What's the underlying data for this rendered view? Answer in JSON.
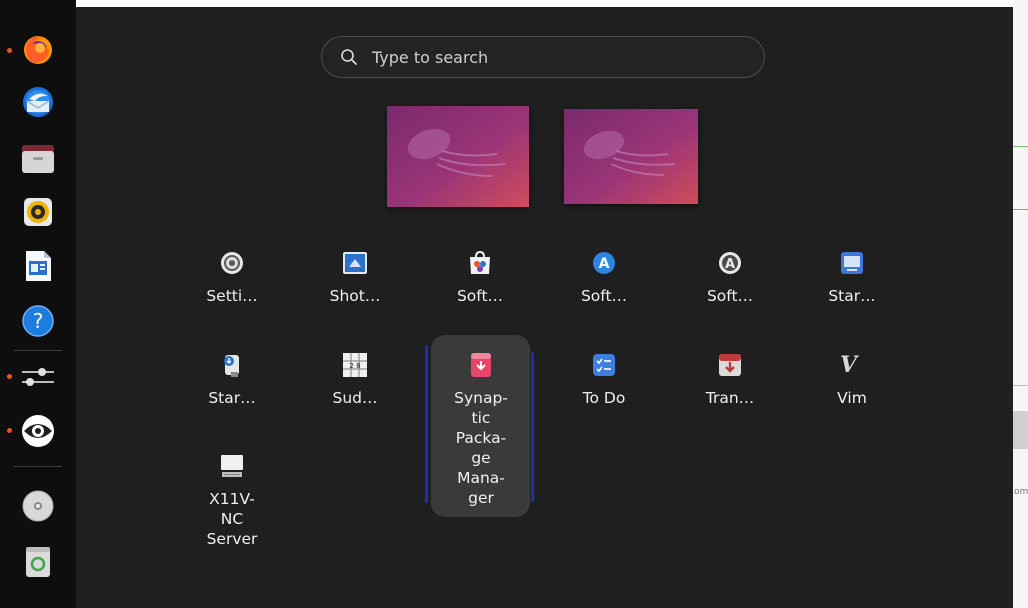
{
  "dock": {
    "items": [
      {
        "name": "firefox",
        "running": true
      },
      {
        "name": "thunderbird",
        "running": false
      },
      {
        "name": "files",
        "running": false
      },
      {
        "name": "rhythmbox",
        "running": false
      },
      {
        "name": "libreoffice-writer",
        "running": false
      },
      {
        "name": "help",
        "running": false
      },
      {
        "name": "settings-sliders",
        "running": true
      },
      {
        "name": "eye-of-gnome",
        "running": true
      },
      {
        "name": "disc",
        "running": false
      },
      {
        "name": "trash",
        "running": false
      }
    ]
  },
  "search": {
    "placeholder": "Type to search"
  },
  "apps": [
    {
      "label": "Setti…",
      "icon": "gear-icon"
    },
    {
      "label": "Shot…",
      "icon": "screenshot-icon"
    },
    {
      "label": "Soft…",
      "icon": "software-icon"
    },
    {
      "label": "Soft…",
      "icon": "software-updater-icon"
    },
    {
      "label": "Soft…",
      "icon": "software-properties-icon"
    },
    {
      "label": "Star…",
      "icon": "startup-disk-icon"
    },
    {
      "label": "Star…",
      "icon": "startup-apps-icon"
    },
    {
      "label": "Sud…",
      "icon": "sudoku-icon"
    },
    {
      "label": "Synap-\ntic\nPacka-\nge\nMana-\nger",
      "icon": "synaptic-icon"
    },
    {
      "label": "To Do",
      "icon": "todo-icon"
    },
    {
      "label": "Tran…",
      "icon": "transmission-icon"
    },
    {
      "label": "Vim",
      "icon": "vim-icon"
    },
    {
      "label": "X11V-\nNC\nServer",
      "icon": "x11vnc-icon"
    }
  ],
  "sudoku_digits": "2 8",
  "vim_letters": "V im",
  "strip_text": "om"
}
